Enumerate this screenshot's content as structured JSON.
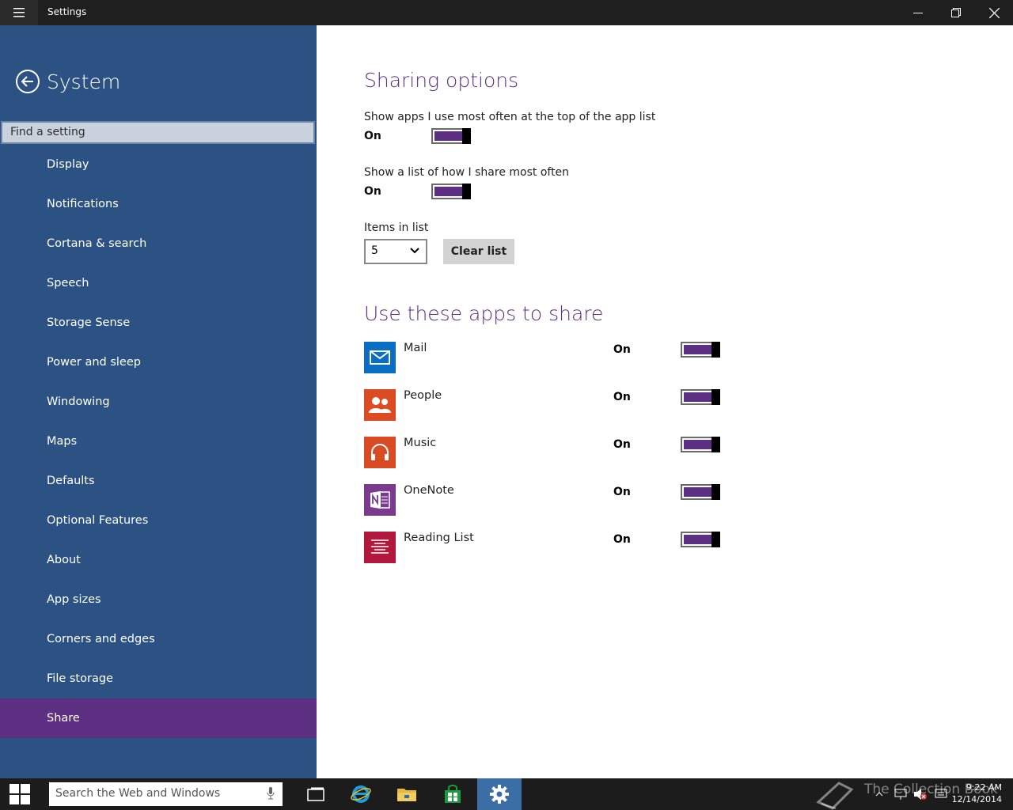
{
  "window": {
    "title": "Settings",
    "icons": {
      "menu": "hamburger-icon",
      "minimize": "minimize-icon",
      "restore": "restore-icon",
      "close": "close-icon"
    }
  },
  "sidebar": {
    "title": "System",
    "search_placeholder": "Find a setting",
    "items": [
      {
        "label": "Display"
      },
      {
        "label": "Notifications"
      },
      {
        "label": "Cortana & search"
      },
      {
        "label": "Speech"
      },
      {
        "label": "Storage Sense"
      },
      {
        "label": "Power and sleep"
      },
      {
        "label": "Windowing"
      },
      {
        "label": "Maps"
      },
      {
        "label": "Defaults"
      },
      {
        "label": "Optional Features"
      },
      {
        "label": "About"
      },
      {
        "label": "App sizes"
      },
      {
        "label": "Corners and edges"
      },
      {
        "label": "File storage"
      },
      {
        "label": "Share",
        "active": true
      }
    ]
  },
  "main": {
    "sharing_options": {
      "heading": "Sharing options",
      "option1": {
        "label": "Show apps I use most often at the top of the app list",
        "state": "On"
      },
      "option2": {
        "label": "Show a list of how I share most often",
        "state": "On"
      },
      "items_label": "Items in list",
      "items_value": "5",
      "clear_button": "Clear list"
    },
    "apps": {
      "heading": "Use these apps to share",
      "list": [
        {
          "name": "Mail",
          "state": "On",
          "icon": "mail-icon",
          "color": "#0a6fc2"
        },
        {
          "name": "People",
          "state": "On",
          "icon": "people-icon",
          "color": "#dc4b21"
        },
        {
          "name": "Music",
          "state": "On",
          "icon": "headphones-icon",
          "color": "#d74b25"
        },
        {
          "name": "OneNote",
          "state": "On",
          "icon": "onenote-icon",
          "color": "#7a3a8e"
        },
        {
          "name": "Reading List",
          "state": "On",
          "icon": "reading-list-icon",
          "color": "#b0183c"
        }
      ]
    }
  },
  "taskbar": {
    "search_placeholder": "Search the Web and Windows",
    "time": "9:22 AM",
    "date": "12/14/2014",
    "watermark": "The Collection Book"
  },
  "colors": {
    "sidebar_bg": "#2b5283",
    "accent": "#5c2f82",
    "titlebar": "#1f1f1f",
    "taskbar": "#1c1c1c"
  }
}
